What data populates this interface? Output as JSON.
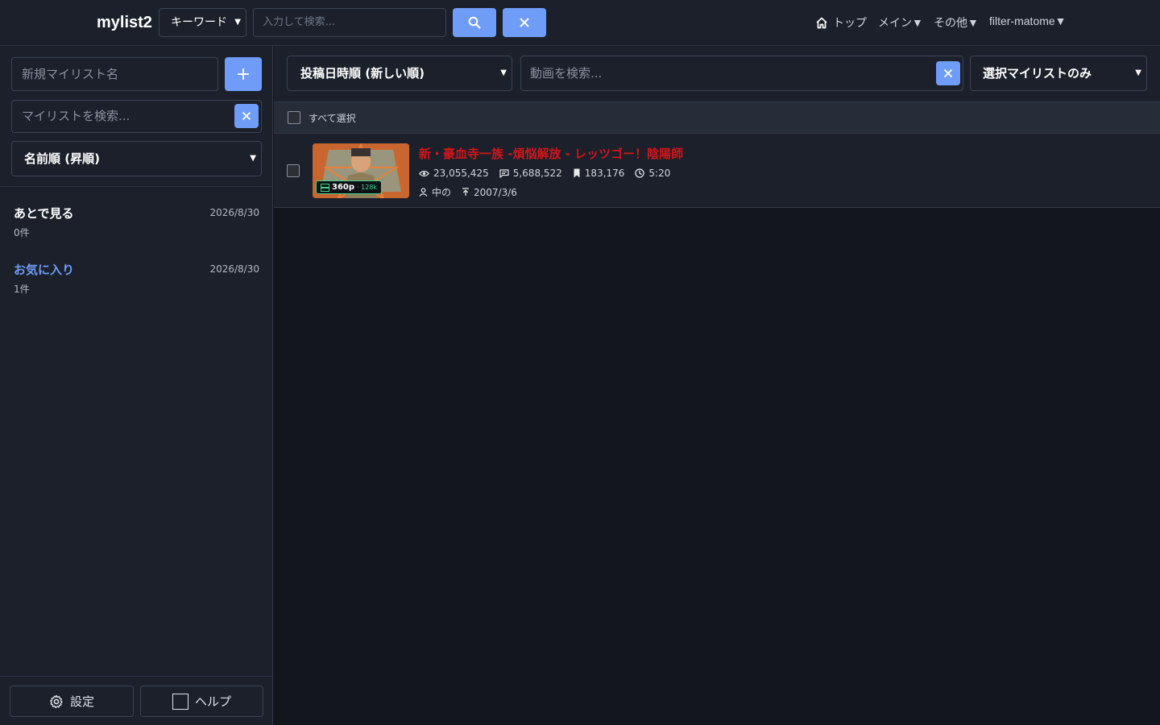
{
  "header": {
    "brand": "mylist2",
    "search_type": "キーワード",
    "search_placeholder": "入力して検索...",
    "nav": {
      "top": "トップ",
      "main": "メイン▼",
      "other": "その他▼",
      "filter": "filter-matome▼"
    }
  },
  "sidebar": {
    "new_mylist_placeholder": "新規マイリスト名",
    "add_label": "+",
    "search_placeholder": "マイリストを検索...",
    "sort_value": "名前順 (昇順)",
    "mylists": [
      {
        "name": "あとで見る",
        "date": "2026/8/30",
        "count": "0件"
      },
      {
        "name": "お気に入り",
        "date": "2026/8/30",
        "count": "1件"
      }
    ],
    "footer": {
      "settings": "設定",
      "help": "ヘルプ"
    }
  },
  "main": {
    "sort_value": "投稿日時順 (新しい順)",
    "video_search_placeholder": "動画を検索...",
    "scope_value": "選択マイリストのみ",
    "select_all_label": "すべて選択",
    "videos": [
      {
        "title": "新・豪血寺一族 -煩悩解放 - レッツゴー！陰陽師",
        "quality": "360p",
        "bitrate": "· 128k",
        "views": "23,055,425",
        "comments": "5,688,522",
        "mylists": "183,176",
        "duration": "5:20",
        "uploader": "中の",
        "upload_date": "2007/3/6"
      }
    ]
  },
  "colors": {
    "accent": "#6f9cf7",
    "title_red": "#d0161b",
    "quality_green": "#3fd28a",
    "panel": "#1b202b",
    "background": "#13161d"
  }
}
